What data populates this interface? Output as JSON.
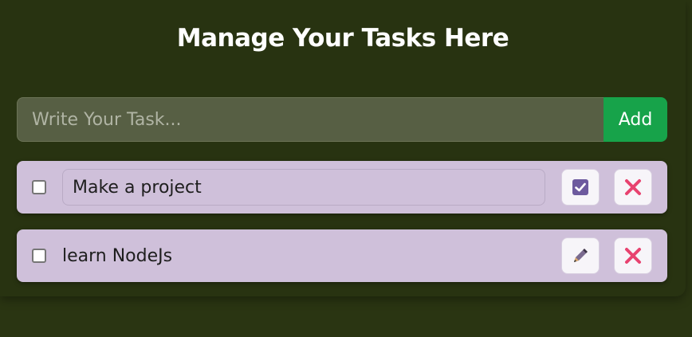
{
  "header": {
    "title": "Manage Your Tasks Here"
  },
  "add_form": {
    "placeholder": "Write Your Task...",
    "add_label": "Add"
  },
  "tasks": [
    {
      "text": "Make a project",
      "completed": false,
      "editing": true,
      "primary_action_icon": "save-check-icon",
      "delete_icon": "delete-x-icon"
    },
    {
      "text": "learn NodeJs",
      "completed": false,
      "editing": false,
      "primary_action_icon": "edit-pencil-icon",
      "delete_icon": "delete-x-icon"
    }
  ],
  "colors": {
    "background": "#2a3512",
    "add_button": "#17a34a",
    "task_card": "#cfc0da",
    "delete_icon": "#e8426f",
    "save_icon": "#6d5a9e"
  }
}
